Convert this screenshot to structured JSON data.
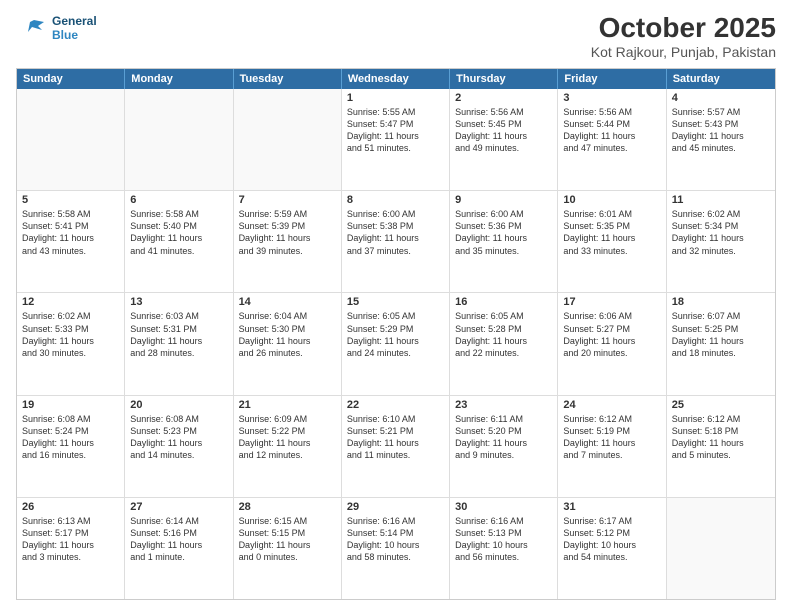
{
  "header": {
    "logo_line1": "General",
    "logo_line2": "Blue",
    "title": "October 2025",
    "subtitle": "Kot Rajkour, Punjab, Pakistan"
  },
  "calendar": {
    "days": [
      "Sunday",
      "Monday",
      "Tuesday",
      "Wednesday",
      "Thursday",
      "Friday",
      "Saturday"
    ],
    "rows": [
      [
        {
          "day": "",
          "lines": []
        },
        {
          "day": "",
          "lines": []
        },
        {
          "day": "",
          "lines": []
        },
        {
          "day": "1",
          "lines": [
            "Sunrise: 5:55 AM",
            "Sunset: 5:47 PM",
            "Daylight: 11 hours",
            "and 51 minutes."
          ]
        },
        {
          "day": "2",
          "lines": [
            "Sunrise: 5:56 AM",
            "Sunset: 5:45 PM",
            "Daylight: 11 hours",
            "and 49 minutes."
          ]
        },
        {
          "day": "3",
          "lines": [
            "Sunrise: 5:56 AM",
            "Sunset: 5:44 PM",
            "Daylight: 11 hours",
            "and 47 minutes."
          ]
        },
        {
          "day": "4",
          "lines": [
            "Sunrise: 5:57 AM",
            "Sunset: 5:43 PM",
            "Daylight: 11 hours",
            "and 45 minutes."
          ]
        }
      ],
      [
        {
          "day": "5",
          "lines": [
            "Sunrise: 5:58 AM",
            "Sunset: 5:41 PM",
            "Daylight: 11 hours",
            "and 43 minutes."
          ]
        },
        {
          "day": "6",
          "lines": [
            "Sunrise: 5:58 AM",
            "Sunset: 5:40 PM",
            "Daylight: 11 hours",
            "and 41 minutes."
          ]
        },
        {
          "day": "7",
          "lines": [
            "Sunrise: 5:59 AM",
            "Sunset: 5:39 PM",
            "Daylight: 11 hours",
            "and 39 minutes."
          ]
        },
        {
          "day": "8",
          "lines": [
            "Sunrise: 6:00 AM",
            "Sunset: 5:38 PM",
            "Daylight: 11 hours",
            "and 37 minutes."
          ]
        },
        {
          "day": "9",
          "lines": [
            "Sunrise: 6:00 AM",
            "Sunset: 5:36 PM",
            "Daylight: 11 hours",
            "and 35 minutes."
          ]
        },
        {
          "day": "10",
          "lines": [
            "Sunrise: 6:01 AM",
            "Sunset: 5:35 PM",
            "Daylight: 11 hours",
            "and 33 minutes."
          ]
        },
        {
          "day": "11",
          "lines": [
            "Sunrise: 6:02 AM",
            "Sunset: 5:34 PM",
            "Daylight: 11 hours",
            "and 32 minutes."
          ]
        }
      ],
      [
        {
          "day": "12",
          "lines": [
            "Sunrise: 6:02 AM",
            "Sunset: 5:33 PM",
            "Daylight: 11 hours",
            "and 30 minutes."
          ]
        },
        {
          "day": "13",
          "lines": [
            "Sunrise: 6:03 AM",
            "Sunset: 5:31 PM",
            "Daylight: 11 hours",
            "and 28 minutes."
          ]
        },
        {
          "day": "14",
          "lines": [
            "Sunrise: 6:04 AM",
            "Sunset: 5:30 PM",
            "Daylight: 11 hours",
            "and 26 minutes."
          ]
        },
        {
          "day": "15",
          "lines": [
            "Sunrise: 6:05 AM",
            "Sunset: 5:29 PM",
            "Daylight: 11 hours",
            "and 24 minutes."
          ]
        },
        {
          "day": "16",
          "lines": [
            "Sunrise: 6:05 AM",
            "Sunset: 5:28 PM",
            "Daylight: 11 hours",
            "and 22 minutes."
          ]
        },
        {
          "day": "17",
          "lines": [
            "Sunrise: 6:06 AM",
            "Sunset: 5:27 PM",
            "Daylight: 11 hours",
            "and 20 minutes."
          ]
        },
        {
          "day": "18",
          "lines": [
            "Sunrise: 6:07 AM",
            "Sunset: 5:25 PM",
            "Daylight: 11 hours",
            "and 18 minutes."
          ]
        }
      ],
      [
        {
          "day": "19",
          "lines": [
            "Sunrise: 6:08 AM",
            "Sunset: 5:24 PM",
            "Daylight: 11 hours",
            "and 16 minutes."
          ]
        },
        {
          "day": "20",
          "lines": [
            "Sunrise: 6:08 AM",
            "Sunset: 5:23 PM",
            "Daylight: 11 hours",
            "and 14 minutes."
          ]
        },
        {
          "day": "21",
          "lines": [
            "Sunrise: 6:09 AM",
            "Sunset: 5:22 PM",
            "Daylight: 11 hours",
            "and 12 minutes."
          ]
        },
        {
          "day": "22",
          "lines": [
            "Sunrise: 6:10 AM",
            "Sunset: 5:21 PM",
            "Daylight: 11 hours",
            "and 11 minutes."
          ]
        },
        {
          "day": "23",
          "lines": [
            "Sunrise: 6:11 AM",
            "Sunset: 5:20 PM",
            "Daylight: 11 hours",
            "and 9 minutes."
          ]
        },
        {
          "day": "24",
          "lines": [
            "Sunrise: 6:12 AM",
            "Sunset: 5:19 PM",
            "Daylight: 11 hours",
            "and 7 minutes."
          ]
        },
        {
          "day": "25",
          "lines": [
            "Sunrise: 6:12 AM",
            "Sunset: 5:18 PM",
            "Daylight: 11 hours",
            "and 5 minutes."
          ]
        }
      ],
      [
        {
          "day": "26",
          "lines": [
            "Sunrise: 6:13 AM",
            "Sunset: 5:17 PM",
            "Daylight: 11 hours",
            "and 3 minutes."
          ]
        },
        {
          "day": "27",
          "lines": [
            "Sunrise: 6:14 AM",
            "Sunset: 5:16 PM",
            "Daylight: 11 hours",
            "and 1 minute."
          ]
        },
        {
          "day": "28",
          "lines": [
            "Sunrise: 6:15 AM",
            "Sunset: 5:15 PM",
            "Daylight: 11 hours",
            "and 0 minutes."
          ]
        },
        {
          "day": "29",
          "lines": [
            "Sunrise: 6:16 AM",
            "Sunset: 5:14 PM",
            "Daylight: 10 hours",
            "and 58 minutes."
          ]
        },
        {
          "day": "30",
          "lines": [
            "Sunrise: 6:16 AM",
            "Sunset: 5:13 PM",
            "Daylight: 10 hours",
            "and 56 minutes."
          ]
        },
        {
          "day": "31",
          "lines": [
            "Sunrise: 6:17 AM",
            "Sunset: 5:12 PM",
            "Daylight: 10 hours",
            "and 54 minutes."
          ]
        },
        {
          "day": "",
          "lines": []
        }
      ]
    ]
  }
}
